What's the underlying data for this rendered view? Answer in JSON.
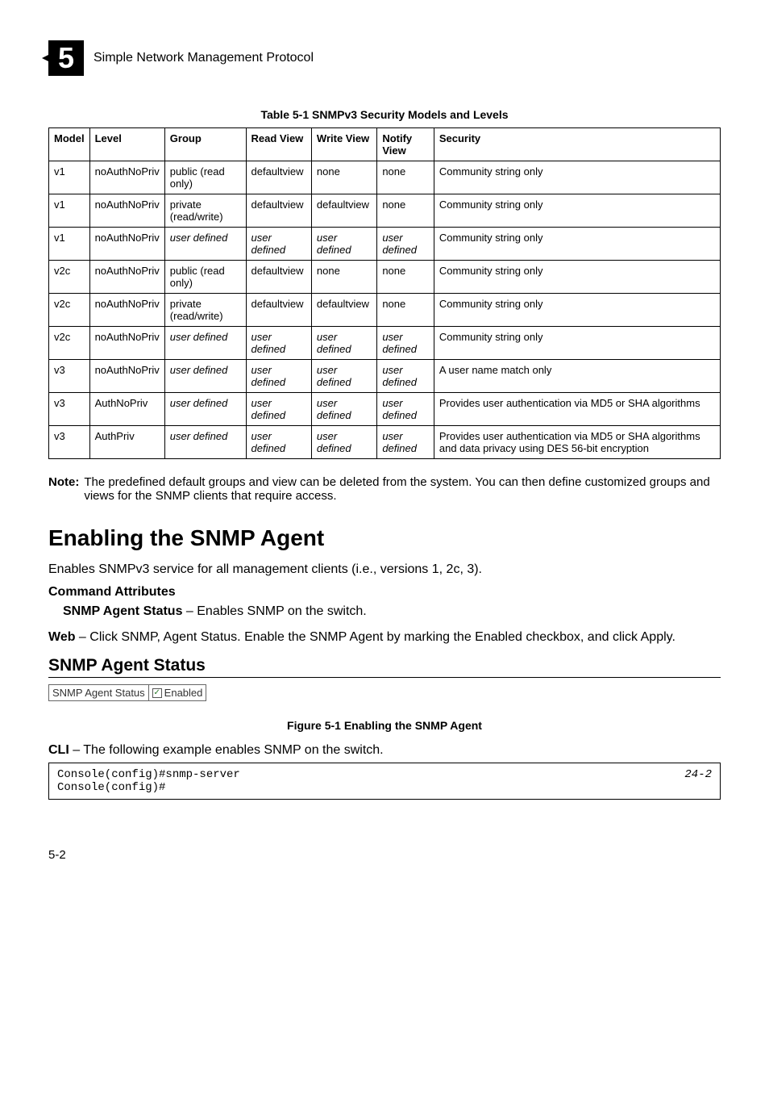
{
  "header": {
    "chapter_number": "5",
    "title": "Simple Network Management Protocol"
  },
  "table": {
    "caption": "Table 5-1   SNMPv3 Security Models and Levels",
    "columns": [
      "Model",
      "Level",
      "Group",
      "Read View",
      "Write View",
      "Notify View",
      "Security"
    ],
    "rows": [
      {
        "model": "v1",
        "level": "noAuthNoPriv",
        "group": "public (read only)",
        "read": "defaultview",
        "write": "none",
        "notify": "none",
        "security": "Community string only"
      },
      {
        "model": "v1",
        "level": "noAuthNoPriv",
        "group": "private (read/write)",
        "read": "defaultview",
        "write": "defaultview",
        "notify": "none",
        "security": "Community string only"
      },
      {
        "model": "v1",
        "level": "noAuthNoPriv",
        "group": "user defined",
        "group_italic": true,
        "read": "user defined",
        "read_italic": true,
        "write": "user defined",
        "write_italic": true,
        "notify": "user defined",
        "notify_italic": true,
        "security": "Community string only"
      },
      {
        "model": "v2c",
        "level": "noAuthNoPriv",
        "group": "public (read only)",
        "read": "defaultview",
        "write": "none",
        "notify": "none",
        "security": "Community string only"
      },
      {
        "model": "v2c",
        "level": "noAuthNoPriv",
        "group": "private (read/write)",
        "read": "defaultview",
        "write": "defaultview",
        "notify": "none",
        "security": "Community string only"
      },
      {
        "model": "v2c",
        "level": "noAuthNoPriv",
        "group": "user defined",
        "group_italic": true,
        "read": "user defined",
        "read_italic": true,
        "write": "user defined",
        "write_italic": true,
        "notify": "user defined",
        "notify_italic": true,
        "security": "Community string only"
      },
      {
        "model": "v3",
        "level": "noAuthNoPriv",
        "group": "user defined",
        "group_italic": true,
        "read": "user defined",
        "read_italic": true,
        "write": "user defined",
        "write_italic": true,
        "notify": "user defined",
        "notify_italic": true,
        "security": "A user name match only"
      },
      {
        "model": "v3",
        "level": "AuthNoPriv",
        "group": "user defined",
        "group_italic": true,
        "read": "user defined",
        "read_italic": true,
        "write": "user defined",
        "write_italic": true,
        "notify": "user defined",
        "notify_italic": true,
        "security": "Provides user authentication via MD5 or SHA algorithms"
      },
      {
        "model": "v3",
        "level": "AuthPriv",
        "group": "user defined",
        "group_italic": true,
        "read": "user defined",
        "read_italic": true,
        "write": "user defined",
        "write_italic": true,
        "notify": "user defined",
        "notify_italic": true,
        "security": "Provides user authentication via MD5 or SHA algorithms and data privacy using DES 56-bit encryption"
      }
    ]
  },
  "note": {
    "label": "Note:",
    "text": "The predefined default groups and view can be deleted from the system. You can then define customized groups and views for the SNMP clients that require access."
  },
  "section": {
    "title": "Enabling the SNMP Agent",
    "intro": "Enables SNMPv3 service for all management clients (i.e., versions 1, 2c, 3).",
    "attr_head": "Command Attributes",
    "attr_name": "SNMP Agent Status",
    "attr_desc": " – Enables SNMP on the switch.",
    "web_label": "Web",
    "web_text": " – Click SNMP, Agent Status. Enable the SNMP Agent by marking the Enabled checkbox, and click Apply."
  },
  "status_widget": {
    "heading": "SNMP Agent Status",
    "cell_label": "SNMP Agent Status",
    "enabled_label": "Enabled",
    "checked": true
  },
  "figure_caption": "Figure 5-1   Enabling the SNMP Agent",
  "cli": {
    "label": "CLI",
    "text": " – The following example enables SNMP on the switch.",
    "code": "Console(config)#snmp-server\nConsole(config)#",
    "ref": "24-2"
  },
  "page_number": "5-2"
}
